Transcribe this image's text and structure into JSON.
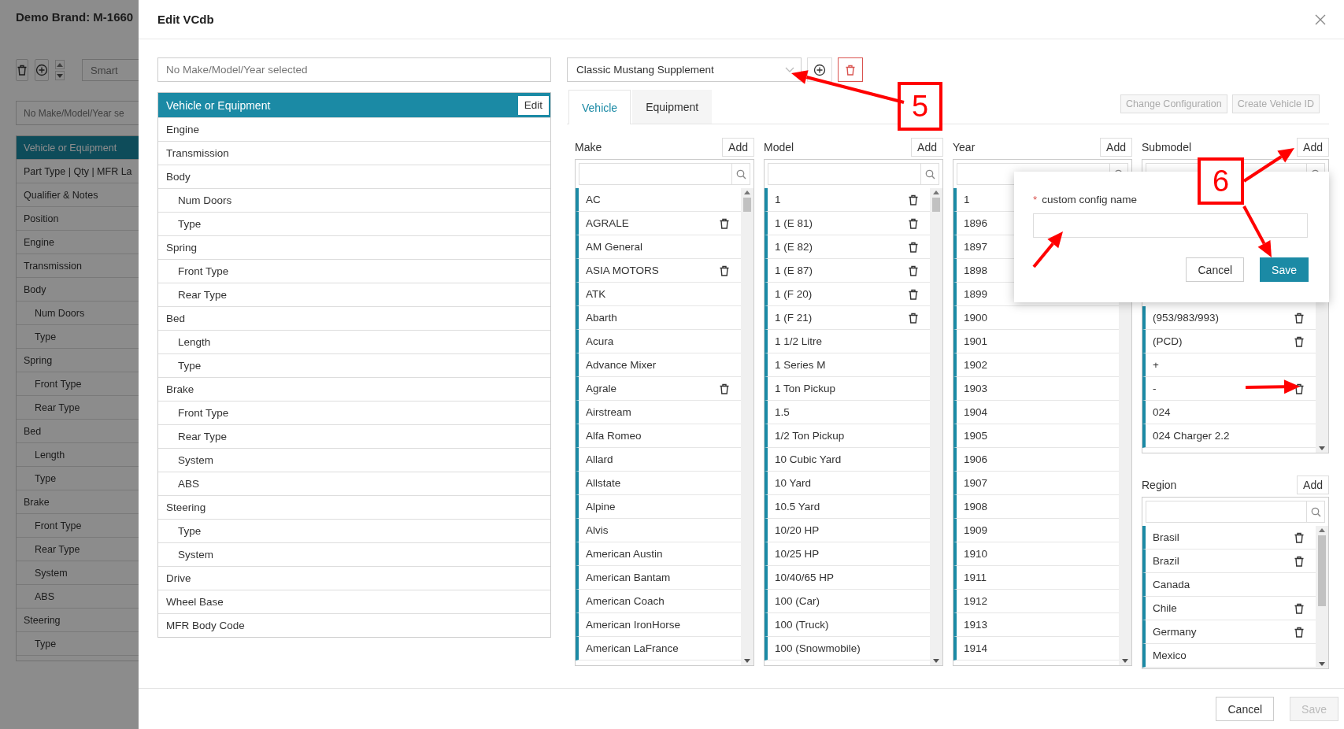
{
  "background_page": {
    "title": "Demo Brand: M-1660",
    "smart_field": {
      "placeholder": "Smart"
    },
    "selection_field": {
      "placeholder": "No Make/Model/Year se"
    },
    "nav_items": [
      {
        "label": "Vehicle or Equipment",
        "selected": true
      },
      {
        "label": "Part Type | Qty | MFR La",
        "selected": false
      },
      {
        "label": "Qualifier & Notes",
        "selected": false
      },
      {
        "label": "Position",
        "selected": false
      },
      {
        "label": "Engine",
        "selected": false
      },
      {
        "label": "Transmission",
        "selected": false
      },
      {
        "label": "Body",
        "selected": false,
        "children": [
          {
            "label": "Num Doors",
            "selected": false
          },
          {
            "label": "Type",
            "selected": false
          }
        ]
      },
      {
        "label": "Spring",
        "selected": false,
        "children": [
          {
            "label": "Front Type",
            "selected": false
          },
          {
            "label": "Rear Type",
            "selected": false
          }
        ]
      },
      {
        "label": "Bed",
        "selected": false,
        "children": [
          {
            "label": "Length",
            "selected": false
          },
          {
            "label": "Type",
            "selected": false
          }
        ]
      },
      {
        "label": "Brake",
        "selected": false,
        "children": [
          {
            "label": "Front Type",
            "selected": false
          },
          {
            "label": "Rear Type",
            "selected": false
          },
          {
            "label": "System",
            "selected": false
          },
          {
            "label": "ABS",
            "selected": false
          }
        ]
      },
      {
        "label": "Steering",
        "selected": false,
        "children": [
          {
            "label": "Type",
            "selected": false
          }
        ]
      }
    ]
  },
  "dialog": {
    "title": "Edit VCdb",
    "selection_field": {
      "placeholder": "No Make/Model/Year selected"
    },
    "tree": [
      {
        "label": "Vehicle or Equipment",
        "selected": true,
        "edit_button": "Edit"
      },
      {
        "label": "Engine",
        "selected": false
      },
      {
        "label": "Transmission",
        "selected": false
      },
      {
        "label": "Body",
        "selected": false,
        "children": [
          {
            "label": "Num Doors",
            "selected": false
          },
          {
            "label": "Type",
            "selected": false
          }
        ]
      },
      {
        "label": "Spring",
        "selected": false,
        "children": [
          {
            "label": "Front Type",
            "selected": false
          },
          {
            "label": "Rear Type",
            "selected": false
          }
        ]
      },
      {
        "label": "Bed",
        "selected": false,
        "children": [
          {
            "label": "Length",
            "selected": false
          },
          {
            "label": "Type",
            "selected": false
          }
        ]
      },
      {
        "label": "Brake",
        "selected": false,
        "children": [
          {
            "label": "Front Type",
            "selected": false
          },
          {
            "label": "Rear Type",
            "selected": false
          },
          {
            "label": "System",
            "selected": false
          },
          {
            "label": "ABS",
            "selected": false
          }
        ]
      },
      {
        "label": "Steering",
        "selected": false,
        "children": [
          {
            "label": "Type",
            "selected": false
          },
          {
            "label": "System",
            "selected": false
          }
        ]
      },
      {
        "label": "Drive",
        "selected": false
      },
      {
        "label": "Wheel Base",
        "selected": false
      },
      {
        "label": "MFR Body Code",
        "selected": false
      }
    ],
    "config_dropdown": {
      "value": "Classic Mustang Supplement"
    },
    "tabs": [
      {
        "label": "Vehicle",
        "selected": true
      },
      {
        "label": "Equipment",
        "selected": false
      }
    ],
    "header_buttons": [
      {
        "label": "Change Configuration",
        "disabled": true
      },
      {
        "label": "Create Vehicle ID",
        "disabled": true
      }
    ],
    "columns": [
      {
        "title": "Make",
        "add_button": "Add",
        "items": [
          {
            "label": "AC",
            "deletable": false
          },
          {
            "label": "AGRALE",
            "deletable": true
          },
          {
            "label": "AM General",
            "deletable": false
          },
          {
            "label": "ASIA MOTORS",
            "deletable": true
          },
          {
            "label": "ATK",
            "deletable": false
          },
          {
            "label": "Abarth",
            "deletable": false
          },
          {
            "label": "Acura",
            "deletable": false
          },
          {
            "label": "Advance Mixer",
            "deletable": false
          },
          {
            "label": "Agrale",
            "deletable": true
          },
          {
            "label": "Airstream",
            "deletable": false
          },
          {
            "label": "Alfa Romeo",
            "deletable": false
          },
          {
            "label": "Allard",
            "deletable": false
          },
          {
            "label": "Allstate",
            "deletable": false
          },
          {
            "label": "Alpine",
            "deletable": false
          },
          {
            "label": "Alvis",
            "deletable": false
          },
          {
            "label": "American Austin",
            "deletable": false
          },
          {
            "label": "American Bantam",
            "deletable": false
          },
          {
            "label": "American Coach",
            "deletable": false
          },
          {
            "label": "American IronHorse",
            "deletable": false
          },
          {
            "label": "American LaFrance",
            "deletable": false
          }
        ]
      },
      {
        "title": "Model",
        "add_button": "Add",
        "items": [
          {
            "label": "1",
            "deletable": true
          },
          {
            "label": "1 (E 81)",
            "deletable": true
          },
          {
            "label": "1 (E 82)",
            "deletable": true
          },
          {
            "label": "1 (E 87)",
            "deletable": true
          },
          {
            "label": "1 (F 20)",
            "deletable": true
          },
          {
            "label": "1 (F 21)",
            "deletable": true
          },
          {
            "label": "1 1/2 Litre",
            "deletable": false
          },
          {
            "label": "1 Series M",
            "deletable": false
          },
          {
            "label": "1 Ton Pickup",
            "deletable": false
          },
          {
            "label": "1.5",
            "deletable": false
          },
          {
            "label": "1/2 Ton Pickup",
            "deletable": false
          },
          {
            "label": "10 Cubic Yard",
            "deletable": false
          },
          {
            "label": "10 Yard",
            "deletable": false
          },
          {
            "label": "10.5 Yard",
            "deletable": false
          },
          {
            "label": "10/20 HP",
            "deletable": false
          },
          {
            "label": "10/25 HP",
            "deletable": false
          },
          {
            "label": "10/40/65 HP",
            "deletable": false
          },
          {
            "label": "100 (Car)",
            "deletable": false
          },
          {
            "label": "100 (Truck)",
            "deletable": false
          },
          {
            "label": "100 (Snowmobile)",
            "deletable": false
          }
        ]
      },
      {
        "title": "Year",
        "add_button": "Add",
        "items": [
          {
            "label": "1",
            "deletable": false
          },
          {
            "label": "1896",
            "deletable": false
          },
          {
            "label": "1897",
            "deletable": false
          },
          {
            "label": "1898",
            "deletable": false
          },
          {
            "label": "1899",
            "deletable": false
          },
          {
            "label": "1900",
            "deletable": false
          },
          {
            "label": "1901",
            "deletable": false
          },
          {
            "label": "1902",
            "deletable": false
          },
          {
            "label": "1903",
            "deletable": false
          },
          {
            "label": "1904",
            "deletable": false
          },
          {
            "label": "1905",
            "deletable": false
          },
          {
            "label": "1906",
            "deletable": false
          },
          {
            "label": "1907",
            "deletable": false
          },
          {
            "label": "1908",
            "deletable": false
          },
          {
            "label": "1909",
            "deletable": false
          },
          {
            "label": "1910",
            "deletable": false
          },
          {
            "label": "1911",
            "deletable": false
          },
          {
            "label": "1912",
            "deletable": false
          },
          {
            "label": "1913",
            "deletable": false
          },
          {
            "label": "1914",
            "deletable": false
          }
        ]
      },
      {
        "title": "Submodel",
        "add_button": "Add",
        "items": [
          {
            "label": "(953/983/993)",
            "deletable": true
          },
          {
            "label": "(PCD)",
            "deletable": true
          },
          {
            "label": "+",
            "deletable": false
          },
          {
            "label": "-",
            "deletable": true
          },
          {
            "label": "024",
            "deletable": false
          },
          {
            "label": "024 Charger 2.2",
            "deletable": false
          }
        ]
      }
    ],
    "region": {
      "title": "Region",
      "add_button": "Add",
      "items": [
        {
          "label": "Brasil",
          "deletable": true
        },
        {
          "label": "Brazil",
          "deletable": true
        },
        {
          "label": "Canada",
          "deletable": false
        },
        {
          "label": "Chile",
          "deletable": true
        },
        {
          "label": "Germany",
          "deletable": true
        },
        {
          "label": "Mexico",
          "deletable": false
        }
      ]
    },
    "popover": {
      "label": "custom config name",
      "required_mark": "*",
      "buttons": [
        {
          "label": "Cancel",
          "kind": "secondary"
        },
        {
          "label": "Save",
          "kind": "primary"
        }
      ]
    },
    "footer_buttons": [
      {
        "label": "Cancel",
        "disabled": false
      },
      {
        "label": "Save",
        "disabled": true
      }
    ]
  },
  "annotations": [
    {
      "label": "5"
    },
    {
      "label": "6"
    }
  ]
}
